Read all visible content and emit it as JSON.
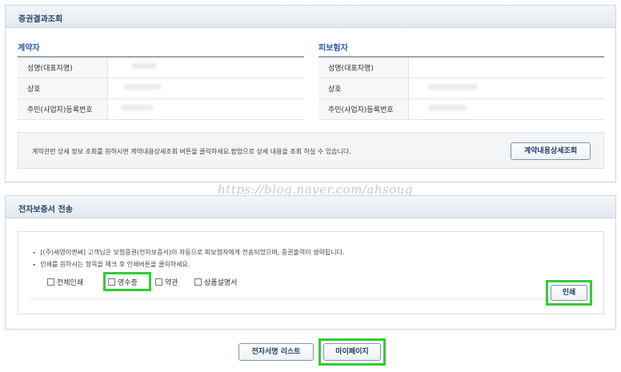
{
  "panel_result": {
    "title": "증권결과조회",
    "contractor": {
      "title": "계약자",
      "rows": [
        {
          "label": "성명(대표자명)"
        },
        {
          "label": "상호"
        },
        {
          "label": "주민(사업자)등록번호"
        }
      ]
    },
    "insured": {
      "title": "피보험자",
      "rows": [
        {
          "label": "성명(대표자명)"
        },
        {
          "label": "상호"
        },
        {
          "label": "주민(사업자)등록번호"
        }
      ]
    },
    "notice": "계약관련 상세 정보 조회를 원하시면 계약내용상세조회 버튼을 클릭하세요.팝업으로 상세 내용을 조회 하실 수 있습니다.",
    "detail_button": "계약내용상세조회"
  },
  "panel_send": {
    "title": "전자보증서 전송",
    "line1": "[(주)세영이앤써] 고객님은 보험증권(전자보증서)이 자동으로 피보험자에게 전송되었으며, 증권출력이 생략됩니다.",
    "line2": "인쇄를 원하시는 항목을 체크 후 인쇄버튼을 클릭하세요.",
    "bullet": "-",
    "checkboxes": [
      "전체인쇄",
      "영수증",
      "약관",
      "상품설명서"
    ],
    "print_button": "인쇄"
  },
  "footer": {
    "esign_list_button": "전자서명 리스트",
    "mypage_button": "마이페이지"
  },
  "watermark": "https://blog.naver.com/ahsoug",
  "colors": {
    "accent": "#2d5bb9",
    "highlight": "#33cc33"
  }
}
